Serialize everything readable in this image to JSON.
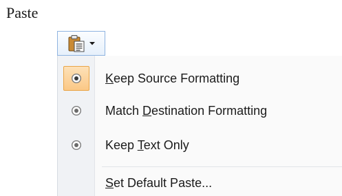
{
  "heading": "Paste",
  "paste_button": {
    "icon": "clipboard-paste-icon",
    "dropdown_icon": "dropdown-arrow-icon"
  },
  "menu": {
    "items": [
      {
        "pre": "",
        "key": "K",
        "post": "eep Source Formatting",
        "icon": "radio-selected-icon",
        "selected": true
      },
      {
        "pre": "Match ",
        "key": "D",
        "post": "estination Formatting",
        "icon": "radio-icon",
        "selected": false
      },
      {
        "pre": "Keep ",
        "key": "T",
        "post": "ext Only",
        "icon": "radio-icon",
        "selected": false
      },
      {
        "pre": "",
        "key": "S",
        "post": "et Default Paste...",
        "icon": "",
        "selected": false
      }
    ]
  },
  "colors": {
    "highlight_fill": "#fbc886",
    "highlight_border": "#e9a547",
    "button_border": "#8eb3e0"
  }
}
